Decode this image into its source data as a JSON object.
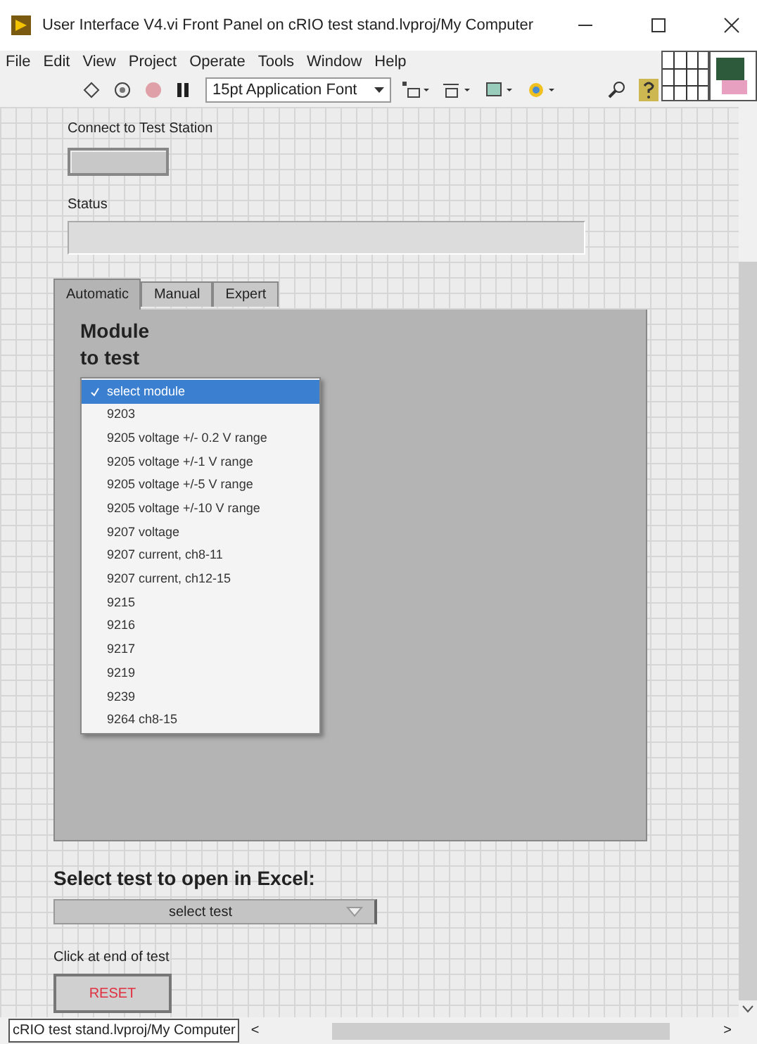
{
  "window": {
    "title": "User Interface V4.vi Front Panel on cRIO test stand.lvproj/My Computer"
  },
  "menu": [
    "File",
    "Edit",
    "View",
    "Project",
    "Operate",
    "Tools",
    "Window",
    "Help"
  ],
  "toolbar": {
    "font": "15pt Application Font"
  },
  "connect": {
    "label": "Connect to Test Station"
  },
  "status": {
    "label": "Status"
  },
  "tabs": [
    {
      "label": "Automatic",
      "selected": true
    },
    {
      "label": "Manual",
      "selected": false
    },
    {
      "label": "Expert",
      "selected": false
    }
  ],
  "module": {
    "label": "Module\nto test",
    "options": [
      {
        "label": "select module",
        "selected": true
      },
      {
        "label": "9203",
        "selected": false
      },
      {
        "label": "9205 voltage +/- 0.2 V range",
        "selected": false
      },
      {
        "label": "9205 voltage +/-1 V range",
        "selected": false
      },
      {
        "label": "9205 voltage +/-5 V range",
        "selected": false
      },
      {
        "label": "9205 voltage +/-10 V range",
        "selected": false
      },
      {
        "label": "9207 voltage",
        "selected": false
      },
      {
        "label": "9207 current, ch8-11",
        "selected": false
      },
      {
        "label": "9207 current, ch12-15",
        "selected": false
      },
      {
        "label": "9215",
        "selected": false
      },
      {
        "label": "9216",
        "selected": false
      },
      {
        "label": "9217",
        "selected": false
      },
      {
        "label": "9219",
        "selected": false
      },
      {
        "label": "9239",
        "selected": false
      },
      {
        "label": "9264 ch8-15",
        "selected": false
      }
    ]
  },
  "excel": {
    "label": "Select test to open in Excel:",
    "value": "select test"
  },
  "reset": {
    "label": "Click at end of test",
    "button": "RESET"
  },
  "status_bar": {
    "path": "cRIO test stand.lvproj/My Computer",
    "scroll_left": "<",
    "scroll_right": ">"
  }
}
